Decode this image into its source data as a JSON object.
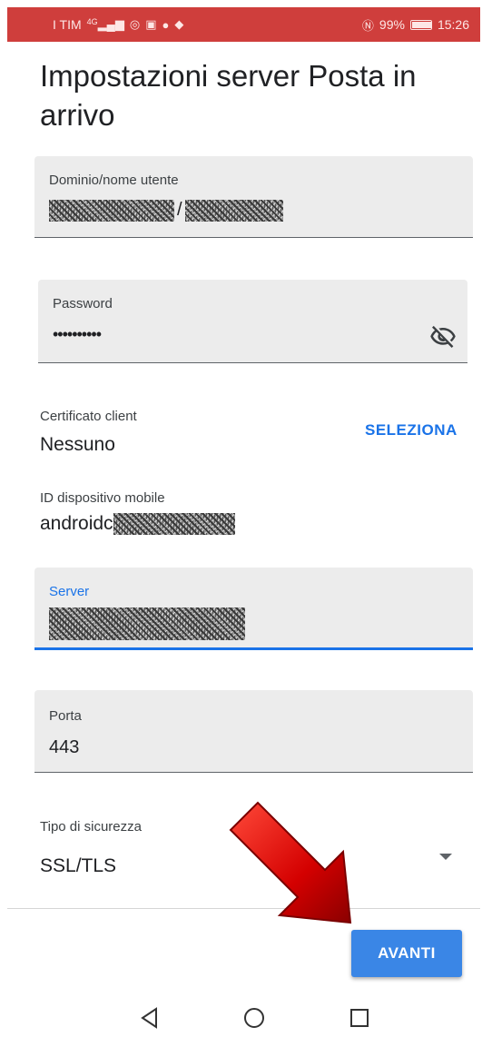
{
  "status_bar": {
    "carrier": "I TIM",
    "signal_text": "4G",
    "battery_percent": "99%",
    "time": "15:26"
  },
  "page": {
    "title": "Impostazioni server Posta in arrivo"
  },
  "domain_field": {
    "label": "Dominio/nome utente",
    "separator": "/"
  },
  "password_field": {
    "label": "Password",
    "value": "••••••••••"
  },
  "client_certificate": {
    "label": "Certificato client",
    "value": "Nessuno",
    "action": "SELEZIONA"
  },
  "device_id": {
    "label": "ID dispositivo mobile",
    "value_prefix": "androidc"
  },
  "server_field": {
    "label": "Server"
  },
  "port_field": {
    "label": "Porta",
    "value": "443"
  },
  "security_type": {
    "label": "Tipo di sicurezza",
    "value": "SSL/TLS"
  },
  "footer": {
    "next_label": "AVANTI"
  },
  "colors": {
    "status_bar": "#cf3e3c",
    "accent": "#1a73e8",
    "button": "#3a86e6",
    "field_bg": "#ececec",
    "annotation_arrow": "#d40000"
  },
  "icons": {
    "password_toggle": "eye-off-icon",
    "dropdown": "chevron-down-icon",
    "nav_back": "back-triangle-icon",
    "nav_home": "home-circle-icon",
    "nav_recents": "recents-square-icon"
  }
}
